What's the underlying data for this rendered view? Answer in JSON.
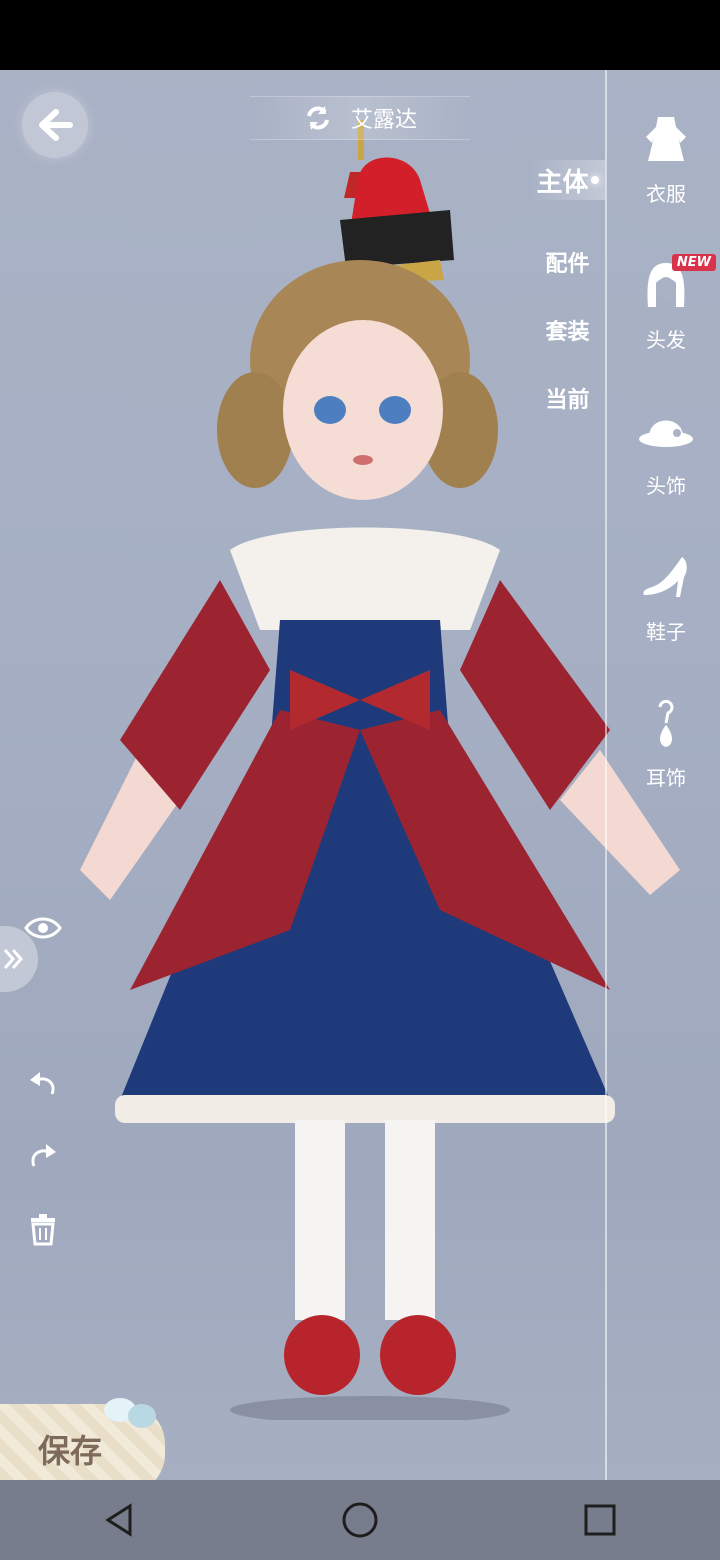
{
  "header": {
    "character_name": "艾露达"
  },
  "tabs": [
    {
      "label": "主体",
      "active": true
    },
    {
      "label": "配件",
      "active": false
    },
    {
      "label": "套装",
      "active": false
    },
    {
      "label": "当前",
      "active": false
    }
  ],
  "categories": [
    {
      "label": "衣服",
      "icon": "dress-icon"
    },
    {
      "label": "头发",
      "icon": "hair-icon",
      "badge": "NEW"
    },
    {
      "label": "头饰",
      "icon": "hat-icon"
    },
    {
      "label": "鞋子",
      "icon": "high-heel-icon"
    },
    {
      "label": "耳饰",
      "icon": "earring-icon"
    }
  ],
  "save": {
    "label": "保存"
  },
  "colors": {
    "background": "#a6afc3",
    "accent_red": "#9b2430",
    "dress_blue": "#1f3a7a",
    "new_badge": "#d8334a"
  }
}
